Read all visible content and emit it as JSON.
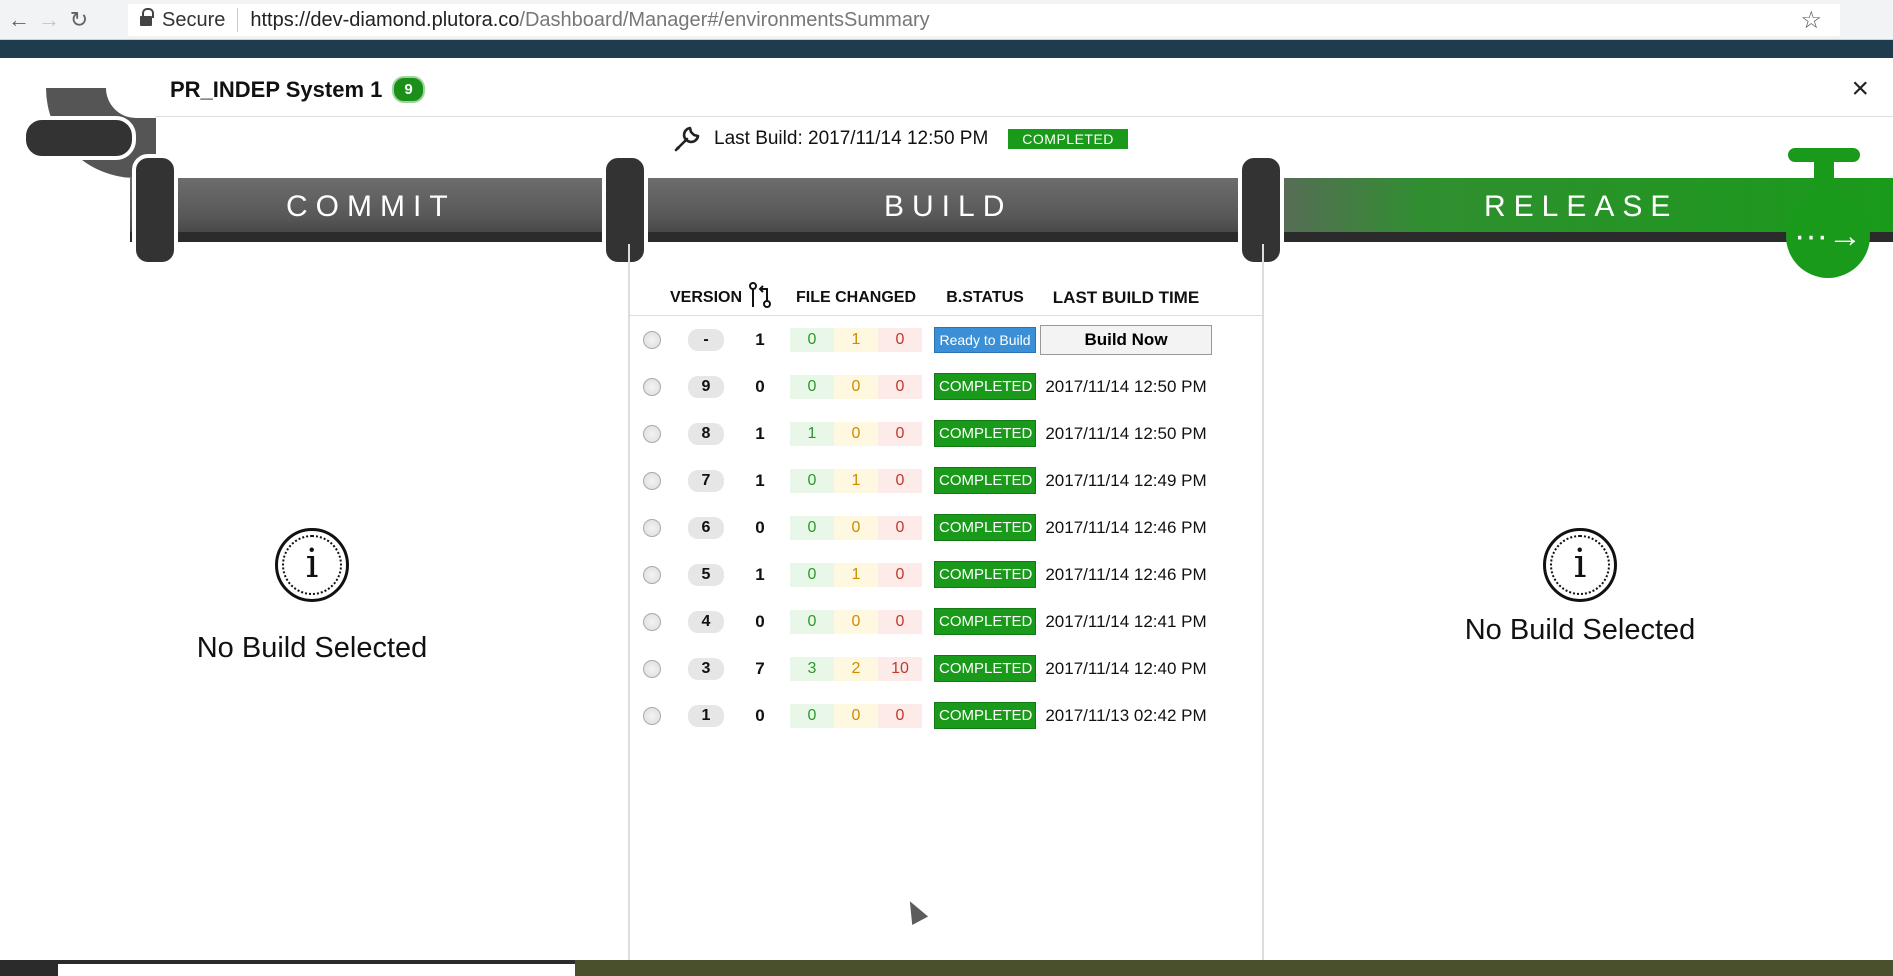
{
  "browser": {
    "secure_label": "Secure",
    "url_host": "https://dev-diamond.plutora.co",
    "url_path": "/Dashboard/Manager#/environmentsSummary"
  },
  "modal": {
    "title": "PR_INDEP System 1",
    "count": "9",
    "close_glyph": "×"
  },
  "last_build": {
    "label": "Last Build: 2017/11/14 12:50 PM",
    "status": "COMPLETED"
  },
  "stages": {
    "commit": "COMMIT",
    "build": "BUILD",
    "release": "RELEASE"
  },
  "tap_glyph": "···→",
  "table": {
    "headers": {
      "version": "VERSION",
      "files": "FILE CHANGED",
      "status": "B.STATUS",
      "time": "LAST BUILD TIME"
    },
    "rows": [
      {
        "version": "-",
        "commits": "1",
        "added": "0",
        "modified": "1",
        "deleted": "0",
        "status": "Ready to Build",
        "time": "",
        "action": "Build Now"
      },
      {
        "version": "9",
        "commits": "0",
        "added": "0",
        "modified": "0",
        "deleted": "0",
        "status": "COMPLETED",
        "time": "2017/11/14 12:50 PM"
      },
      {
        "version": "8",
        "commits": "1",
        "added": "1",
        "modified": "0",
        "deleted": "0",
        "status": "COMPLETED",
        "time": "2017/11/14 12:50 PM"
      },
      {
        "version": "7",
        "commits": "1",
        "added": "0",
        "modified": "1",
        "deleted": "0",
        "status": "COMPLETED",
        "time": "2017/11/14 12:49 PM"
      },
      {
        "version": "6",
        "commits": "0",
        "added": "0",
        "modified": "0",
        "deleted": "0",
        "status": "COMPLETED",
        "time": "2017/11/14 12:46 PM"
      },
      {
        "version": "5",
        "commits": "1",
        "added": "0",
        "modified": "1",
        "deleted": "0",
        "status": "COMPLETED",
        "time": "2017/11/14 12:46 PM"
      },
      {
        "version": "4",
        "commits": "0",
        "added": "0",
        "modified": "0",
        "deleted": "0",
        "status": "COMPLETED",
        "time": "2017/11/14 12:41 PM"
      },
      {
        "version": "3",
        "commits": "7",
        "added": "3",
        "modified": "2",
        "deleted": "10",
        "status": "COMPLETED",
        "time": "2017/11/14 12:40 PM"
      },
      {
        "version": "1",
        "commits": "0",
        "added": "0",
        "modified": "0",
        "deleted": "0",
        "status": "COMPLETED",
        "time": "2017/11/13 02:42 PM"
      }
    ]
  },
  "commit_panel": {
    "message": "No Build Selected",
    "icon": "info-icon"
  },
  "release_panel": {
    "message": "No Build Selected",
    "icon": "info-icon"
  },
  "colors": {
    "green": "#1a9a1a",
    "blue": "#3a8fd6",
    "pipe": "#585858"
  }
}
